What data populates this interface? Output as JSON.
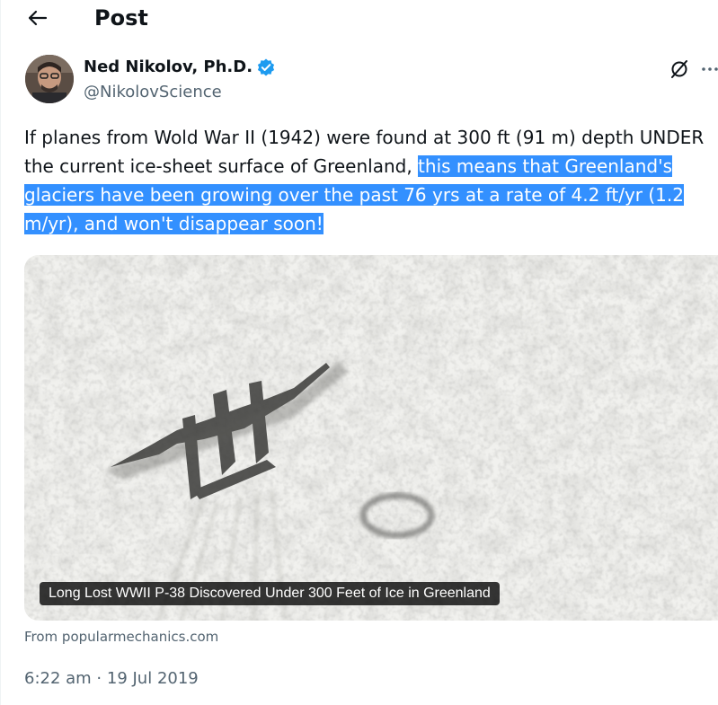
{
  "header": {
    "title": "Post"
  },
  "author": {
    "name": "Ned Nikolov, Ph.D.",
    "handle": "@NikolovScience",
    "verified_color": "#1d9bf0"
  },
  "tweet": {
    "text_plain": "If planes from Wold War II (1942) were found at 300 ft (91 m) depth UNDER the current ice-sheet surface of Greenland, ",
    "text_highlighted": "this means that Greenland's glaciers have been growing over the past 76 yrs at a rate of 4.2 ft/yr (1.2 m/yr), and won't disappear soon!",
    "highlight_color": "#3390ff"
  },
  "media": {
    "caption": "Long Lost WWII P-38 Discovered Under 300 Feet of Ice in Greenland"
  },
  "source": "From popularmechanics.com",
  "timestamp": "6:22 am · 19 Jul 2019",
  "icons": {
    "back": "arrow-left-icon",
    "verified": "verified-badge-icon",
    "grok": "grok-icon",
    "more": "more-dots-icon"
  }
}
